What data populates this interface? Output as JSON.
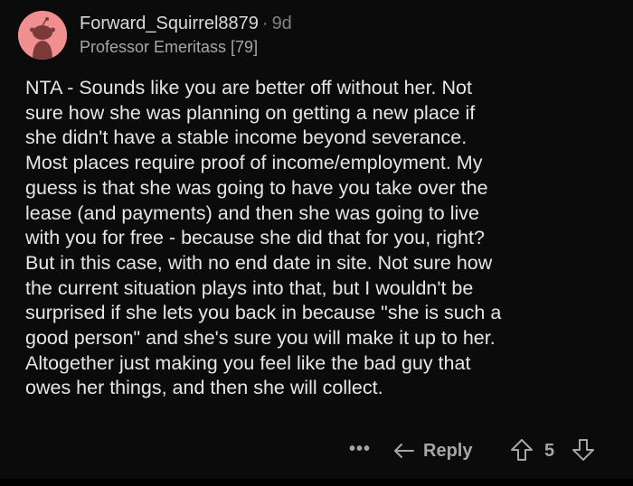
{
  "comment": {
    "username": "Forward_Squirrel8879",
    "separator": "·",
    "age": "9d",
    "flair": "Professor Emeritass [79]",
    "body_lines": [
      "NTA - Sounds like you are better off without her. Not",
      "sure how she was planning on getting a new place if",
      "she didn't have a stable income beyond severance.",
      "Most places require proof of income/employment. My",
      "guess is that she was going to have you take over the",
      "lease (and payments) and then she was going to live",
      "with you for free - because she did that for you, right?",
      "But in this case, with no end date in site. Not sure how",
      "the current situation plays into that, but I wouldn't be",
      "surprised if she lets you back in because \"she is such a",
      "good person\" and she's sure you will make it up to her.",
      "Altogether just making you feel like the bad guy that",
      "owes her things, and then she will collect."
    ]
  },
  "actions": {
    "more_label": "•••",
    "reply_label": "Reply",
    "score": "5"
  },
  "icons": {
    "avatar": "snoo-avatar-icon",
    "reply": "reply-arrow-icon",
    "upvote": "upvote-arrow-icon",
    "downvote": "downvote-arrow-icon"
  },
  "colors": {
    "background": "#0b0b0b",
    "text": "#e4e6e7",
    "muted": "#a4a7a9",
    "avatar_bg": "#f08f8f"
  }
}
